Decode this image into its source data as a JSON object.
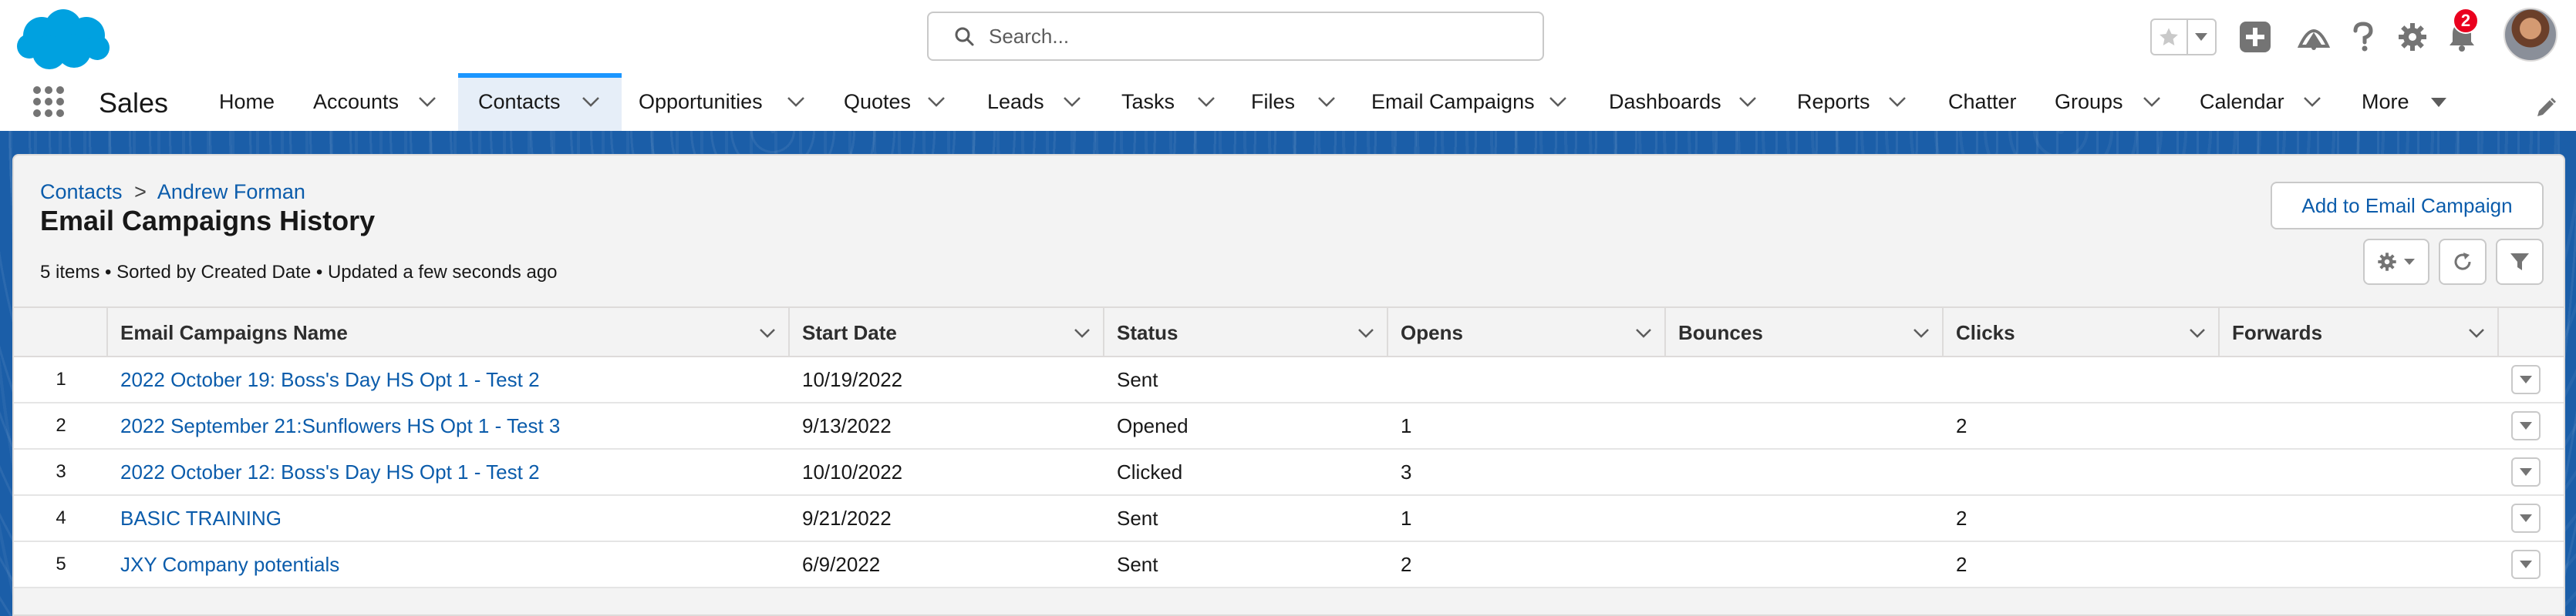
{
  "header": {
    "search_placeholder": "Search...",
    "notification_count": "2",
    "icons": [
      "salesforce-cloud-logo",
      "search-icon",
      "star-icon",
      "chevron-down-icon",
      "plus-icon",
      "trailhead-icon",
      "help-icon",
      "gear-icon",
      "bell-icon",
      "avatar"
    ]
  },
  "nav": {
    "app_name": "Sales",
    "items": [
      {
        "label": "Home",
        "has_menu": false
      },
      {
        "label": "Accounts",
        "has_menu": true
      },
      {
        "label": "Contacts",
        "has_menu": true,
        "active": true
      },
      {
        "label": "Opportunities",
        "has_menu": true
      },
      {
        "label": "Quotes",
        "has_menu": true
      },
      {
        "label": "Leads",
        "has_menu": true
      },
      {
        "label": "Tasks",
        "has_menu": true
      },
      {
        "label": "Files",
        "has_menu": true
      },
      {
        "label": "Email Campaigns",
        "has_menu": true
      },
      {
        "label": "Dashboards",
        "has_menu": true
      },
      {
        "label": "Reports",
        "has_menu": true
      },
      {
        "label": "Chatter",
        "has_menu": false
      },
      {
        "label": "Groups",
        "has_menu": true
      },
      {
        "label": "Calendar",
        "has_menu": true
      },
      {
        "label": "More",
        "has_menu": true
      }
    ]
  },
  "page": {
    "breadcrumb": {
      "root": "Contacts",
      "separator": ">",
      "record": "Andrew Forman"
    },
    "title": "Email Campaigns History",
    "list_info": "5 items • Sorted by Created Date • Updated a few seconds ago",
    "add_button": "Add to Email Campaign"
  },
  "table": {
    "columns": [
      "Email Campaigns Name",
      "Start Date",
      "Status",
      "Opens",
      "Bounces",
      "Clicks",
      "Forwards"
    ],
    "rows": [
      {
        "num": "1",
        "name": "2022 October 19: Boss's Day HS Opt 1 - Test 2",
        "start_date": "10/19/2022",
        "status": "Sent",
        "opens": "",
        "bounces": "",
        "clicks": "",
        "forwards": ""
      },
      {
        "num": "2",
        "name": "2022 September 21:Sunflowers HS Opt 1 - Test 3",
        "start_date": "9/13/2022",
        "status": "Opened",
        "opens": "1",
        "bounces": "",
        "clicks": "2",
        "forwards": ""
      },
      {
        "num": "3",
        "name": "2022 October 12: Boss's Day HS Opt 1 - Test 2",
        "start_date": "10/10/2022",
        "status": "Clicked",
        "opens": "3",
        "bounces": "",
        "clicks": "",
        "forwards": ""
      },
      {
        "num": "4",
        "name": "BASIC TRAINING",
        "start_date": "9/21/2022",
        "status": "Sent",
        "opens": "1",
        "bounces": "",
        "clicks": "2",
        "forwards": ""
      },
      {
        "num": "5",
        "name": "JXY Company potentials",
        "start_date": "6/9/2022",
        "status": "Sent",
        "opens": "2",
        "bounces": "",
        "clicks": "2",
        "forwards": ""
      }
    ]
  },
  "colors": {
    "brand_blue": "#0b5cab",
    "accent": "#1b96ff",
    "page_band": "#1b5ea8",
    "badge": "#ea001e",
    "logo": "#00a1e0"
  }
}
